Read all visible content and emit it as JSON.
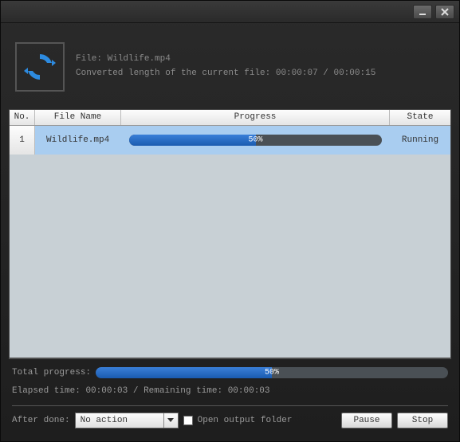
{
  "info": {
    "file_label": "File:",
    "file_name": "Wildlife.mp4",
    "converted_label": "Converted length of the current file:",
    "converted_elapsed": "00:00:07",
    "converted_total": "00:00:15"
  },
  "table": {
    "headers": {
      "no": "No.",
      "name": "File Name",
      "progress": "Progress",
      "state": "State"
    },
    "rows": [
      {
        "no": "1",
        "name": "Wildlife.mp4",
        "percent": 50,
        "percent_label": "50%",
        "state": "Running"
      }
    ]
  },
  "footer": {
    "total_label": "Total progress:",
    "total_percent": 50,
    "total_percent_label": "50%",
    "elapsed_label": "Elapsed time:",
    "elapsed_value": "00:00:03",
    "remaining_label": "Remaining time:",
    "remaining_value": "00:00:03"
  },
  "actions": {
    "after_done_label": "After done:",
    "after_done_value": "No action",
    "open_folder_label": "Open output folder",
    "open_folder_checked": false,
    "pause": "Pause",
    "stop": "Stop"
  }
}
